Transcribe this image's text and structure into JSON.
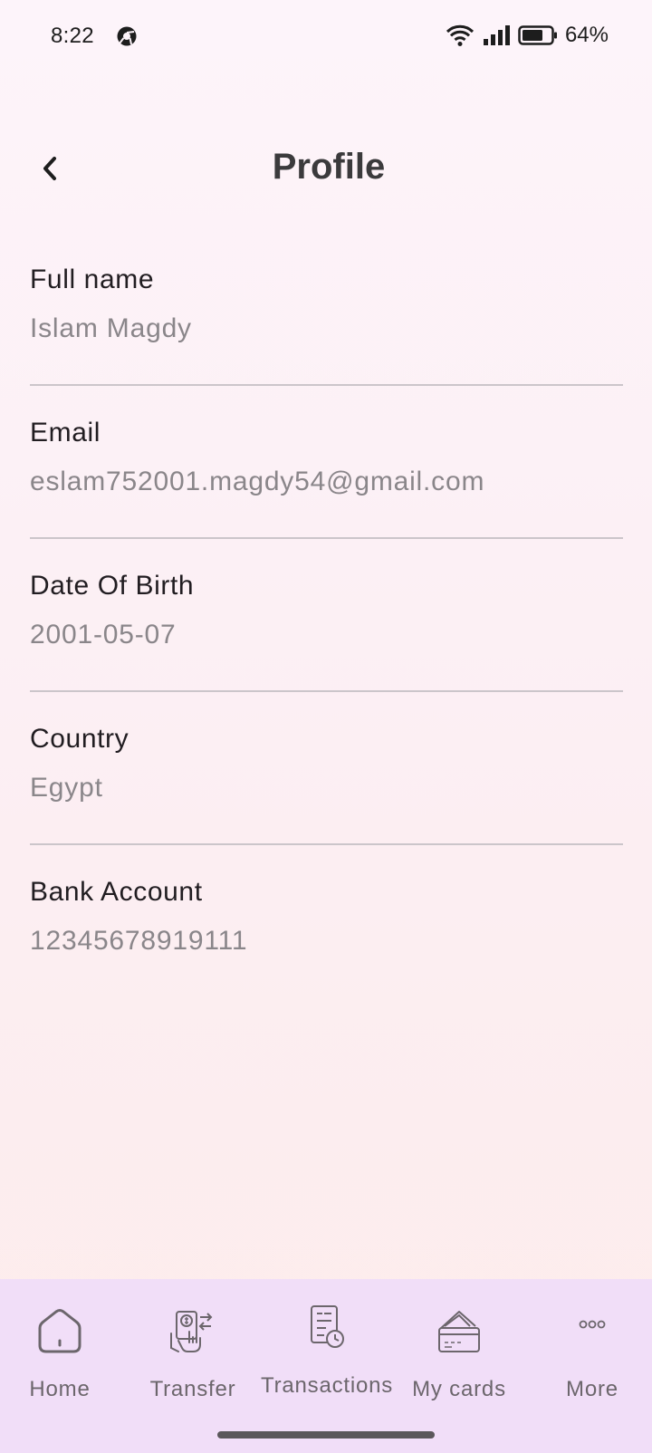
{
  "status_bar": {
    "time": "8:22",
    "battery": "64%",
    "icons": [
      "wifi-icon",
      "signal-icon",
      "battery-icon"
    ]
  },
  "header": {
    "title": "Profile",
    "back_icon": "chevron-left-icon"
  },
  "profile": {
    "fields": [
      {
        "label": "Full name",
        "value": "Islam Magdy"
      },
      {
        "label": "Email",
        "value": "eslam752001.magdy54@gmail.com"
      },
      {
        "label": "Date Of Birth",
        "value": "2001-05-07"
      },
      {
        "label": "Country",
        "value": "Egypt"
      },
      {
        "label": "Bank Account",
        "value": "12345678919111"
      }
    ]
  },
  "bottom_nav": {
    "items": [
      {
        "label": "Home",
        "icon": "home-icon"
      },
      {
        "label": "Transfer",
        "icon": "transfer-icon"
      },
      {
        "label": "Transactions",
        "icon": "transactions-icon"
      },
      {
        "label": "My cards",
        "icon": "cards-icon"
      },
      {
        "label": "More",
        "icon": "more-icon"
      }
    ]
  },
  "colors": {
    "background": "#fdf1f5",
    "nav_background": "#f1def8",
    "label": "#211d21",
    "value": "#8a868a",
    "divider": "#cbc5ca",
    "nav_label": "#6c666c"
  }
}
